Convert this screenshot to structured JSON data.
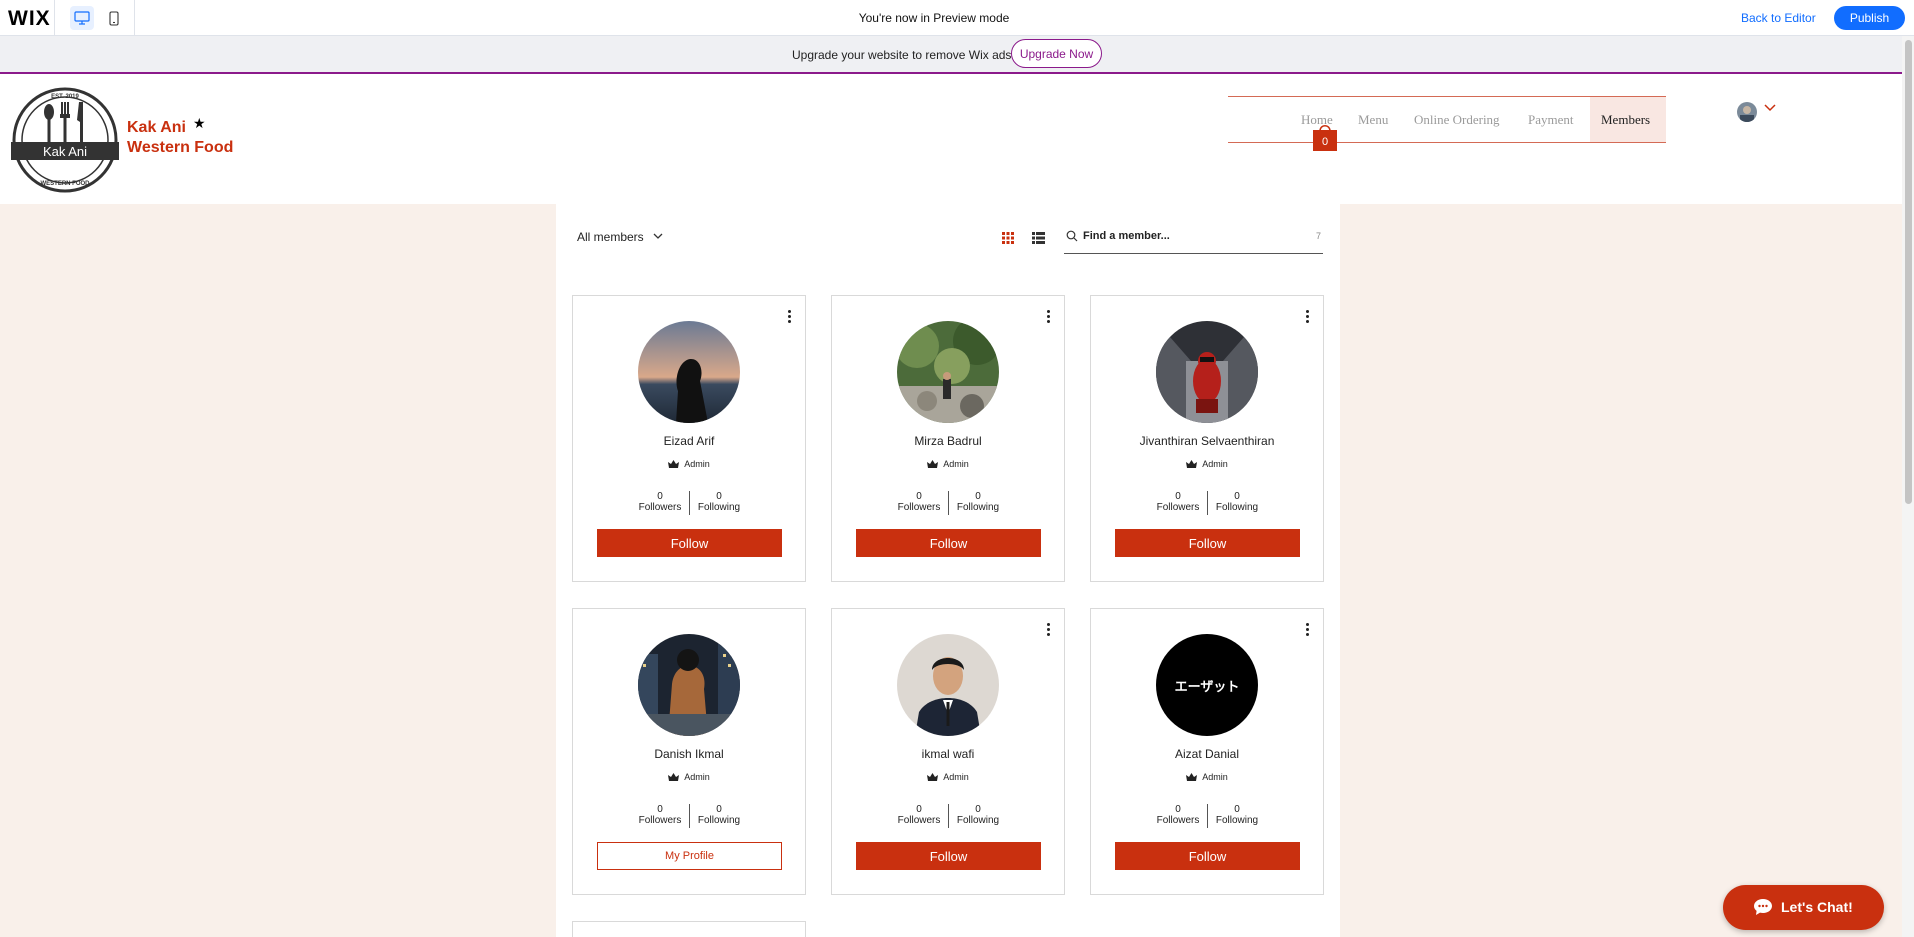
{
  "editor_bar": {
    "logo": "WIX",
    "preview_text": "You're now in Preview mode",
    "back_to_editor": "Back to Editor",
    "publish": "Publish"
  },
  "upgrade_bar": {
    "text": "Upgrade your website to remove Wix ads",
    "button": "Upgrade Now"
  },
  "site": {
    "logo_text": "Kak Ani",
    "logo_ring_top": "EST. 2019",
    "logo_ring_bottom": "WESTERN FOOD",
    "brand_line1": "Kak Ani",
    "brand_line2": "Western Food",
    "brand_star": "★",
    "nav": [
      "Home",
      "Menu",
      "Online Ordering",
      "Payment",
      "Members"
    ],
    "active_nav": "Members",
    "cart_count": "0"
  },
  "members_page": {
    "filter_label": "All members",
    "search_placeholder": "Find a member...",
    "member_count": "7",
    "members": [
      {
        "name": "Eizad Arif",
        "role": "Admin",
        "followers": "0",
        "following": "0",
        "button": "Follow"
      },
      {
        "name": "Mirza Badrul",
        "role": "Admin",
        "followers": "0",
        "following": "0",
        "button": "Follow"
      },
      {
        "name": "Jivanthiran Selvaenthiran",
        "role": "Admin",
        "followers": "0",
        "following": "0",
        "button": "Follow"
      },
      {
        "name": "Danish Ikmal",
        "role": "Admin",
        "followers": "0",
        "following": "0",
        "button": "My Profile"
      },
      {
        "name": "ikmal wafi",
        "role": "Admin",
        "followers": "0",
        "following": "0",
        "button": "Follow"
      },
      {
        "name": "Aizat Danial",
        "role": "Admin",
        "followers": "0",
        "following": "0",
        "button": "Follow",
        "avatar_text": "エーザット"
      }
    ],
    "followers_label": "Followers",
    "following_label": "Following"
  },
  "chat": {
    "label": "Let's Chat!"
  },
  "colors": {
    "accent": "#c9300f",
    "page_bg": "#f9f0ea",
    "wix_blue": "#116dff",
    "upgrade_purple": "#8b1a8b"
  }
}
